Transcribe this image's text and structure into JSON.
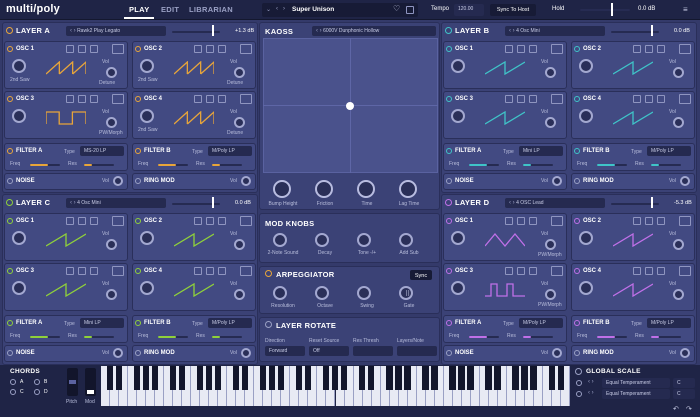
{
  "app": {
    "logo": "multi/poly"
  },
  "tabs": [
    "PLAY",
    "EDIT",
    "LIBRARIAN"
  ],
  "top": {
    "preset": "Super Unison",
    "tempo_label": "Tempo",
    "tempo": "120.00",
    "sync": "Sync To Host",
    "hold": "Hold",
    "vol": "0.0 dB"
  },
  "layers": [
    {
      "name": "LAYER A",
      "preset": "Rawk2 Play Legato",
      "db": "+1.3 dB",
      "color": "#e8a53a",
      "osc": [
        {
          "label": "OSC 1",
          "sub": "2nd Saw",
          "knob": "Detune"
        },
        {
          "label": "OSC 2",
          "sub": "2nd Saw",
          "knob": "Detune"
        },
        {
          "label": "OSC 3",
          "sub": "",
          "knob": "PW/Morph"
        },
        {
          "label": "OSC 4",
          "sub": "2nd Saw",
          "knob": "Detune"
        }
      ],
      "filterA": {
        "label": "FILTER A",
        "type": "MS-20 LP"
      },
      "filterB": {
        "label": "FILTER B",
        "type": "M/Poly LP"
      }
    },
    {
      "name": "LAYER B",
      "preset": "4 Osc Mini",
      "db": "0.0 dB",
      "color": "#3fc4c8",
      "osc": [
        {
          "label": "OSC 1",
          "sub": "",
          "knob": ""
        },
        {
          "label": "OSC 2",
          "sub": "",
          "knob": ""
        },
        {
          "label": "OSC 3",
          "sub": "",
          "knob": ""
        },
        {
          "label": "OSC 4",
          "sub": "",
          "knob": ""
        }
      ],
      "filterA": {
        "label": "FILTER A",
        "type": "Mini LP"
      },
      "filterB": {
        "label": "FILTER B",
        "type": "M/Poly LP"
      }
    },
    {
      "name": "LAYER C",
      "preset": "4 Osc Mini",
      "db": "0.0 dB",
      "color": "#8fd13a",
      "osc": [
        {
          "label": "OSC 1",
          "sub": "",
          "knob": ""
        },
        {
          "label": "OSC 2",
          "sub": "",
          "knob": ""
        },
        {
          "label": "OSC 3",
          "sub": "",
          "knob": ""
        },
        {
          "label": "OSC 4",
          "sub": "",
          "knob": ""
        }
      ],
      "filterA": {
        "label": "FILTER A",
        "type": "Mini LP"
      },
      "filterB": {
        "label": "FILTER B",
        "type": "M/Poly LP"
      }
    },
    {
      "name": "LAYER D",
      "preset": "4 OSC Lead",
      "db": "-5.3 dB",
      "color": "#c070e8",
      "osc": [
        {
          "label": "OSC 1",
          "sub": "",
          "knob": "PW/Morph"
        },
        {
          "label": "OSC 2",
          "sub": "",
          "knob": ""
        },
        {
          "label": "OSC 3",
          "sub": "",
          "knob": "PW/Morph"
        },
        {
          "label": "OSC 4",
          "sub": "",
          "knob": ""
        }
      ],
      "filterA": {
        "label": "FILTER A",
        "type": "M/Poly LP"
      },
      "filterB": {
        "label": "FILTER B",
        "type": "M/Poly LP"
      }
    }
  ],
  "common": {
    "vol": "Vol",
    "type": "Type",
    "freq": "Freq",
    "res": "Res",
    "noise": "NOISE",
    "ringmod": "RING MOD"
  },
  "kaoss": {
    "title": "KAOSS",
    "preset": "6000V Dunphonic Hollow",
    "knobs": [
      "Bump Height",
      "Friction",
      "Time",
      "Lag Time"
    ]
  },
  "modknobs": {
    "title": "MOD KNOBS",
    "knobs": [
      "2-Note Sound",
      "Decay",
      "Tone -/+",
      "Add Sub"
    ]
  },
  "arp": {
    "title": "ARPEGGIATOR",
    "sync": "Sync",
    "knobs": [
      "Resolution",
      "Octave",
      "Swing",
      "Gate"
    ]
  },
  "rotate": {
    "title": "LAYER ROTATE",
    "labels": [
      "Direction",
      "Reset Source",
      "Res Thresh",
      "Layers/Note"
    ],
    "values": [
      "Forward",
      "Off",
      "",
      ""
    ]
  },
  "chords": {
    "title": "CHORDS",
    "items": [
      "A",
      "B",
      "C",
      "D"
    ]
  },
  "pitch": "Pitch",
  "mod": "Mod",
  "scale": {
    "title": "GLOBAL SCALE",
    "rows": [
      {
        "value": "Equal Temperament",
        "key": "C"
      },
      {
        "value": "Equal Temperament",
        "key": "C"
      }
    ]
  }
}
